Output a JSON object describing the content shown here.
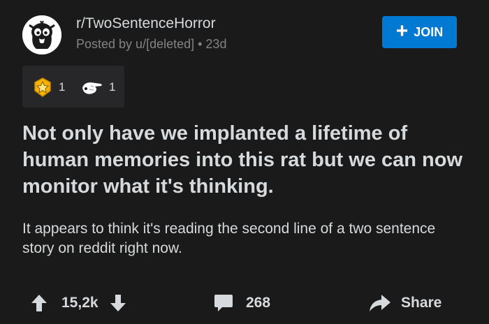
{
  "post": {
    "subreddit": "r/TwoSentenceHorror",
    "posted_by": "Posted by u/[deleted] • 23d",
    "join_label": "JOIN",
    "awards": [
      {
        "icon": "silver-star-award-icon",
        "count": "1"
      },
      {
        "icon": "pointing-hand-award-icon",
        "count": "1"
      }
    ],
    "title": "Not only have we implanted a lifetime of human memories into this rat but we can now monitor what it's thinking.",
    "body": "It appears to think it's reading the second line of a two sentence story on reddit right now.",
    "votes": "15,2k",
    "comments": "268",
    "share_label": "Share"
  },
  "colors": {
    "background": "#1a1a1b",
    "join_button": "#0079d3",
    "text": "#d7dadc",
    "meta_text": "#818384",
    "award_box": "#272729"
  }
}
